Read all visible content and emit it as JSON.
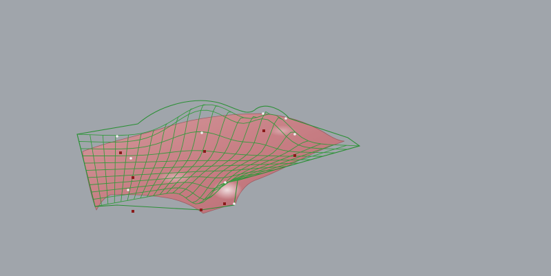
{
  "viewport": {
    "background": "#a0a5ab",
    "surface_fill": "#c97a80",
    "surface_edge": "#9c5a60",
    "wire_color": "#2f9a3a",
    "control_point_color": "#8a1a1a",
    "vertex_point_color": "#f2f2f2"
  },
  "scene": {
    "objects": [
      {
        "name": "nurbs-surface",
        "kind": "shaded-surface"
      },
      {
        "name": "wireframe-mesh",
        "kind": "wireframe"
      }
    ],
    "control_point_count": 8,
    "vertex_point_count": 9
  }
}
